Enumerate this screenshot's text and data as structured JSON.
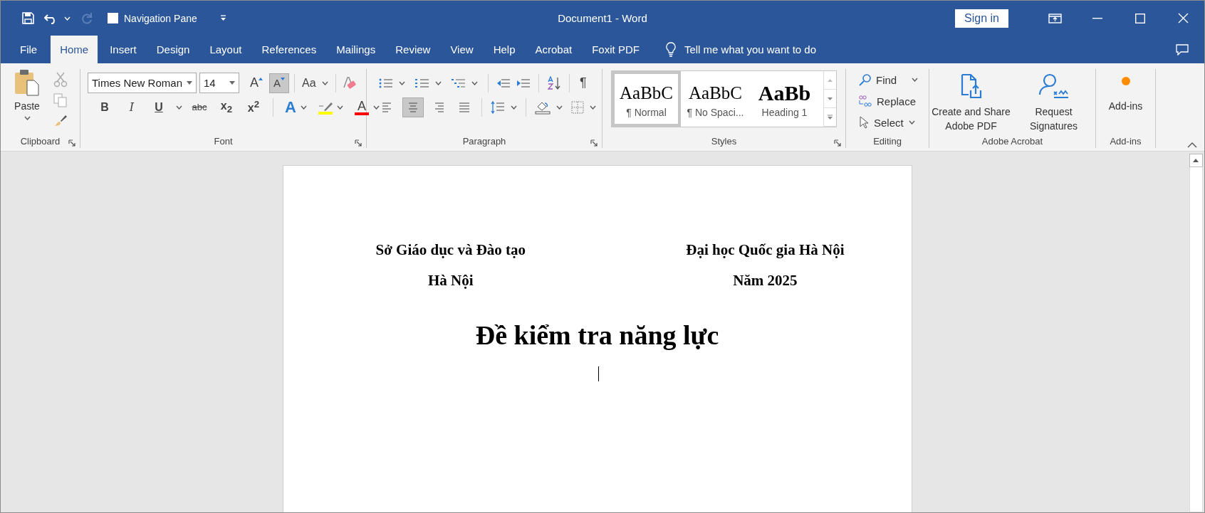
{
  "window": {
    "title": "Document1  -  Word",
    "sign_in": "Sign in"
  },
  "quick_access": {
    "redo": {
      "disabled": true
    },
    "navigation_pane": {
      "label": "Navigation Pane",
      "checked": false
    }
  },
  "tabs": [
    {
      "label": "File",
      "selected": false
    },
    {
      "label": "Home",
      "selected": true
    },
    {
      "label": "Insert",
      "selected": false
    },
    {
      "label": "Design",
      "selected": false
    },
    {
      "label": "Layout",
      "selected": false
    },
    {
      "label": "References",
      "selected": false
    },
    {
      "label": "Mailings",
      "selected": false
    },
    {
      "label": "Review",
      "selected": false
    },
    {
      "label": "View",
      "selected": false
    },
    {
      "label": "Help",
      "selected": false
    },
    {
      "label": "Acrobat",
      "selected": false
    },
    {
      "label": "Foxit PDF",
      "selected": false
    }
  ],
  "tell_me": {
    "label": "Tell me what you want to do"
  },
  "ribbon": {
    "groups": [
      {
        "kind": "clipboard",
        "label": "Clipboard",
        "paste": "Paste"
      },
      {
        "kind": "font",
        "label": "Font",
        "font_name": "Times New Roman",
        "font_size": "14",
        "size_buttons": [
          {
            "label": "A",
            "kind": "grow",
            "selected": false
          },
          {
            "label": "A",
            "kind": "shrink",
            "selected": true
          }
        ],
        "change_case": "Aa",
        "format_buttons": [
          {
            "label": "B",
            "kind": "bold"
          },
          {
            "label": "I",
            "kind": "italic"
          },
          {
            "label": "U",
            "kind": "underline"
          },
          {
            "label": "abc",
            "kind": "strike"
          },
          {
            "label": "x$_{2}$",
            "kind": "subscript"
          },
          {
            "label": "x$^{2}$",
            "kind": "superscript"
          }
        ],
        "text_effects": "A",
        "font_color": "A"
      },
      {
        "kind": "paragraph",
        "label": "Paragraph",
        "show_marks": "¶",
        "alignments": [
          {
            "kind": "left",
            "selected": false
          },
          {
            "kind": "center",
            "selected": true
          },
          {
            "kind": "right",
            "selected": false
          },
          {
            "kind": "justify",
            "selected": false
          }
        ]
      },
      {
        "kind": "styles",
        "label": "Styles",
        "items": [
          {
            "kind": "normal",
            "preview": "AaBbC",
            "label": "¶ Normal",
            "selected": true
          },
          {
            "kind": "no-spacing",
            "preview": "AaBbC",
            "label": "¶ No Spaci...",
            "selected": false
          },
          {
            "kind": "heading",
            "preview": "AaBb",
            "label": "Heading 1",
            "selected": false
          }
        ]
      },
      {
        "kind": "editing",
        "label": "Editing",
        "find": "Find",
        "replace": "Replace",
        "select": "Select"
      },
      {
        "kind": "acrobat",
        "label": "Adobe Acrobat",
        "buttons": [
          {
            "kind": "create-pdf",
            "label": "Create and Share Adobe PDF"
          },
          {
            "kind": "signatures",
            "label": "Request Signatures"
          }
        ]
      },
      {
        "kind": "addins",
        "label": "Add-ins",
        "button": "Add-ins"
      }
    ]
  },
  "document": {
    "header_left": [
      "Sở Giáo dục và Đào tạo",
      "Hà Nội"
    ],
    "header_right": [
      "Đại học Quốc gia Hà Nội",
      "Năm 2025"
    ],
    "title": "Đề kiểm tra năng lực"
  }
}
